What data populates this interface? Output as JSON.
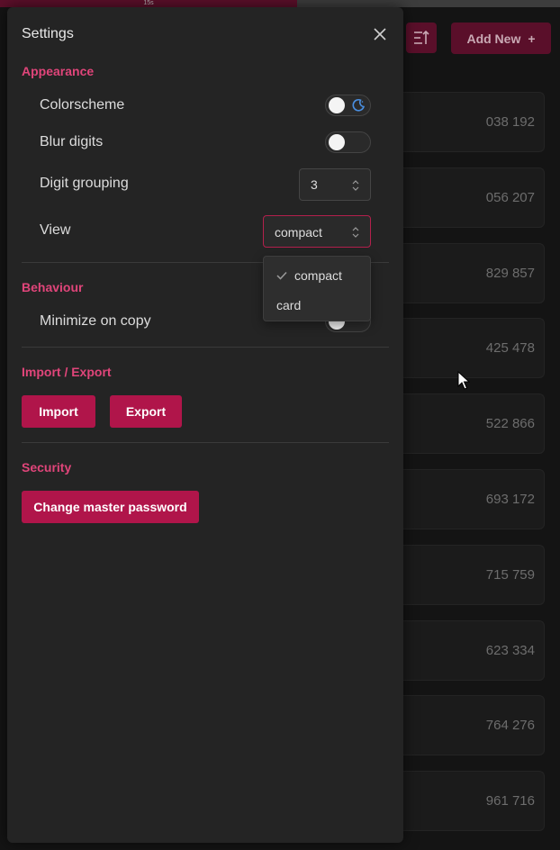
{
  "timer": {
    "label": "15s",
    "progress": 0.53
  },
  "header": {
    "add_new_label": "Add New",
    "add_new_plus": "+"
  },
  "codes": [
    "038 192",
    "056 207",
    "829 857",
    "425 478",
    "522 866",
    "693 172",
    "715 759",
    "623 334",
    "764 276",
    "961 716"
  ],
  "settings": {
    "title": "Settings",
    "appearance": {
      "title": "Appearance",
      "colorscheme_label": "Colorscheme",
      "blur_digits_label": "Blur digits",
      "digit_grouping_label": "Digit grouping",
      "digit_grouping_value": "3",
      "view_label": "View",
      "view_value": "compact",
      "view_options": [
        "compact",
        "card"
      ]
    },
    "behaviour": {
      "title": "Behaviour",
      "minimize_label": "Minimize on copy"
    },
    "import_export": {
      "title": "Import / Export",
      "import_label": "Import",
      "export_label": "Export"
    },
    "security": {
      "title": "Security",
      "change_password_label": "Change master password"
    }
  },
  "colors": {
    "accent": "#b0154a",
    "section_title": "#e0457a",
    "panel": "#242424"
  }
}
